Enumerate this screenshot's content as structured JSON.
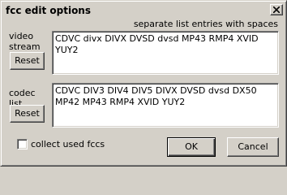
{
  "window": {
    "title": "fcc edit options"
  },
  "hint": "separate list entries with spaces",
  "video_stream": {
    "label": "video stream list",
    "value": "CDVC divx DIVX DVSD dvsd MP43 RMP4 XVID YUY2",
    "reset_label": "Reset"
  },
  "codec": {
    "label": "codec list",
    "value": "CDVC DIV3 DIV4 DIV5 DIVX DVSD dvsd DX50 MP42 MP43 RMP4 XVID YUY2",
    "reset_label": "Reset"
  },
  "collect_used": {
    "label": "collect used fccs",
    "checked": false
  },
  "buttons": {
    "ok_label": "OK",
    "cancel_label": "Cancel"
  },
  "icons": {
    "close": "close-icon"
  }
}
